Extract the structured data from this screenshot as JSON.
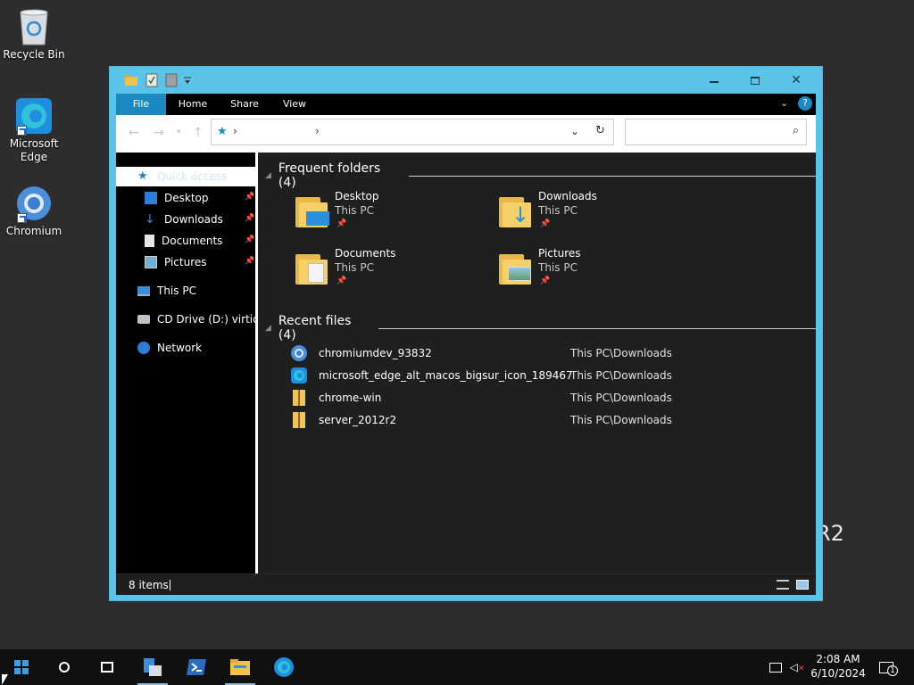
{
  "desktop": {
    "icons": [
      {
        "label": "Recycle Bin"
      },
      {
        "label": "Microsoft Edge"
      },
      {
        "label": "Chromium"
      }
    ],
    "watermark": "R2"
  },
  "window": {
    "title": "",
    "ribbon_tabs": [
      "File",
      "Home",
      "Share",
      "View"
    ],
    "address": "",
    "search_placeholder": ""
  },
  "nav_pane": {
    "items": [
      {
        "label": "Quick access",
        "icon": "star-icon",
        "selected": true
      },
      {
        "label": "Desktop",
        "icon": "desktop-icon",
        "pinned": true
      },
      {
        "label": "Downloads",
        "icon": "download-icon",
        "pinned": true
      },
      {
        "label": "Documents",
        "icon": "document-icon",
        "pinned": true
      },
      {
        "label": "Pictures",
        "icon": "picture-icon",
        "pinned": true
      },
      {
        "label": "This PC",
        "icon": "monitor-icon"
      },
      {
        "label": "CD Drive (D:) virtio-w",
        "icon": "cd-drive-icon"
      },
      {
        "label": "Network",
        "icon": "network-icon"
      }
    ]
  },
  "frequent": {
    "header": "Frequent folders (4)",
    "folders": [
      {
        "name": "Desktop",
        "location": "This PC"
      },
      {
        "name": "Downloads",
        "location": "This PC"
      },
      {
        "name": "Documents",
        "location": "This PC"
      },
      {
        "name": "Pictures",
        "location": "This PC"
      }
    ]
  },
  "recent": {
    "header": "Recent files (4)",
    "files": [
      {
        "name": "chromiumdev_93832",
        "location": "This PC\\Downloads",
        "icon": "chromium-file-icon"
      },
      {
        "name": "microsoft_edge_alt_macos_bigsur_icon_189467",
        "location": "This PC\\Downloads",
        "icon": "edge-file-icon"
      },
      {
        "name": "chrome-win",
        "location": "This PC\\Downloads",
        "icon": "zip-folder-icon"
      },
      {
        "name": "server_2012r2",
        "location": "This PC\\Downloads",
        "icon": "zip-folder-icon"
      }
    ]
  },
  "status": {
    "items_text": "8 items"
  },
  "taskbar": {
    "time": "2:08 AM",
    "date": "6/10/2024",
    "notification_count": "1"
  },
  "colors": {
    "titlebar": "#5ac4e8",
    "file_tab": "#1b8ac2",
    "dark_bg": "#1f1f1f",
    "folder": "#f5cf68"
  }
}
